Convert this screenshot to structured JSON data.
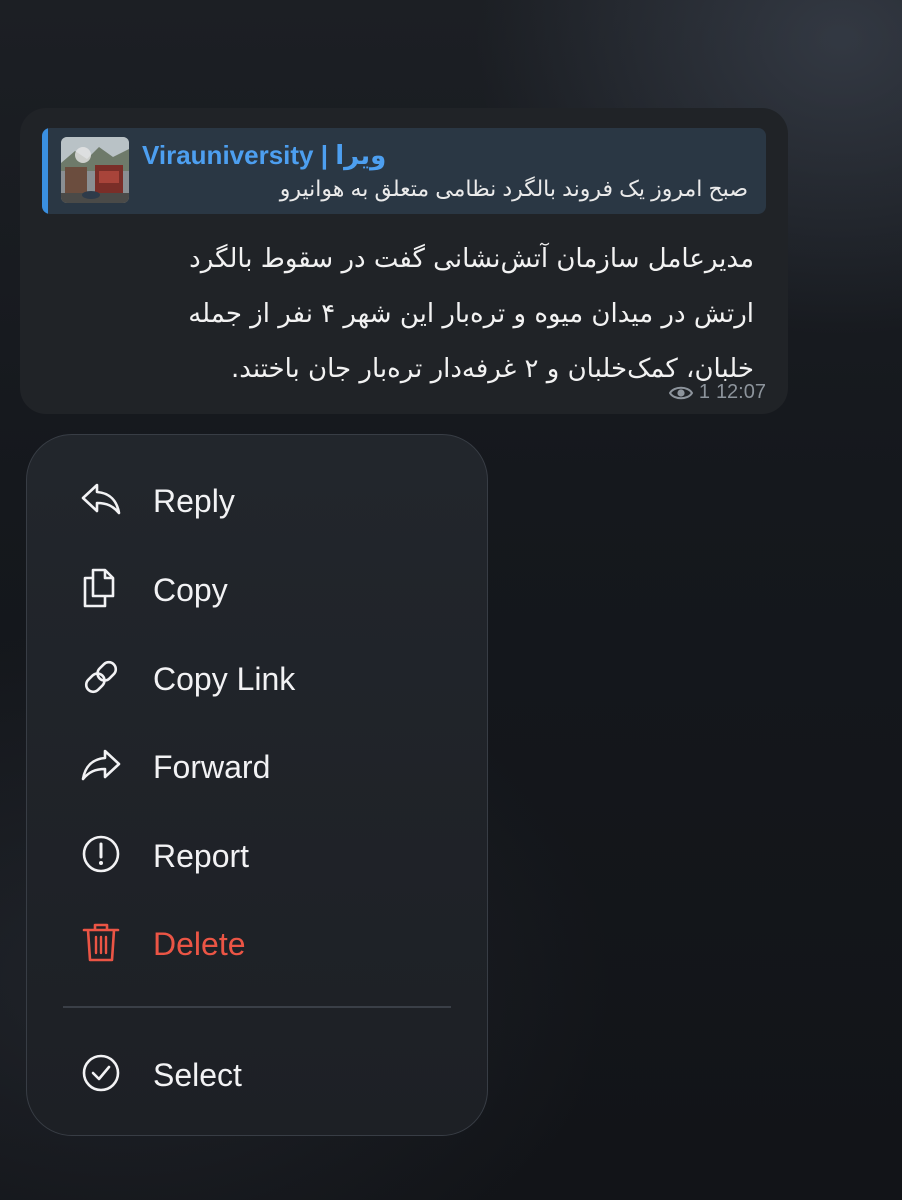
{
  "message": {
    "reply": {
      "channel": "Virauniversity | ویرا",
      "snippet": "صبح امروز یک فروند بالگرد نظامی متعلق به هوانیرو"
    },
    "lines": [
      "مدیرعامل سازمان آتش‌نشانی گفت در سقوط بالگرد",
      "ارتش در میدان میوه و تره‌بار این شهر ۴ نفر از جمله",
      "خلبان، کمک‌خلبان و ۲ غرفه‌دار تره‌بار جان باختند."
    ],
    "views": "1",
    "time": "12:07",
    "views_icon": "eye-icon"
  },
  "menu": {
    "items": [
      {
        "label": "Reply",
        "icon": "reply-icon"
      },
      {
        "label": "Copy",
        "icon": "copy-icon"
      },
      {
        "label": "Copy Link",
        "icon": "link-icon"
      },
      {
        "label": "Forward",
        "icon": "forward-icon"
      },
      {
        "label": "Report",
        "icon": "report-icon"
      },
      {
        "label": "Delete",
        "icon": "trash-icon"
      },
      {
        "label": "Select",
        "icon": "check-circle-icon"
      }
    ]
  },
  "colors": {
    "accent": "#4d9ff0",
    "danger": "#eb5545",
    "bubble": "#202327",
    "menu_background": "#1f2227"
  }
}
